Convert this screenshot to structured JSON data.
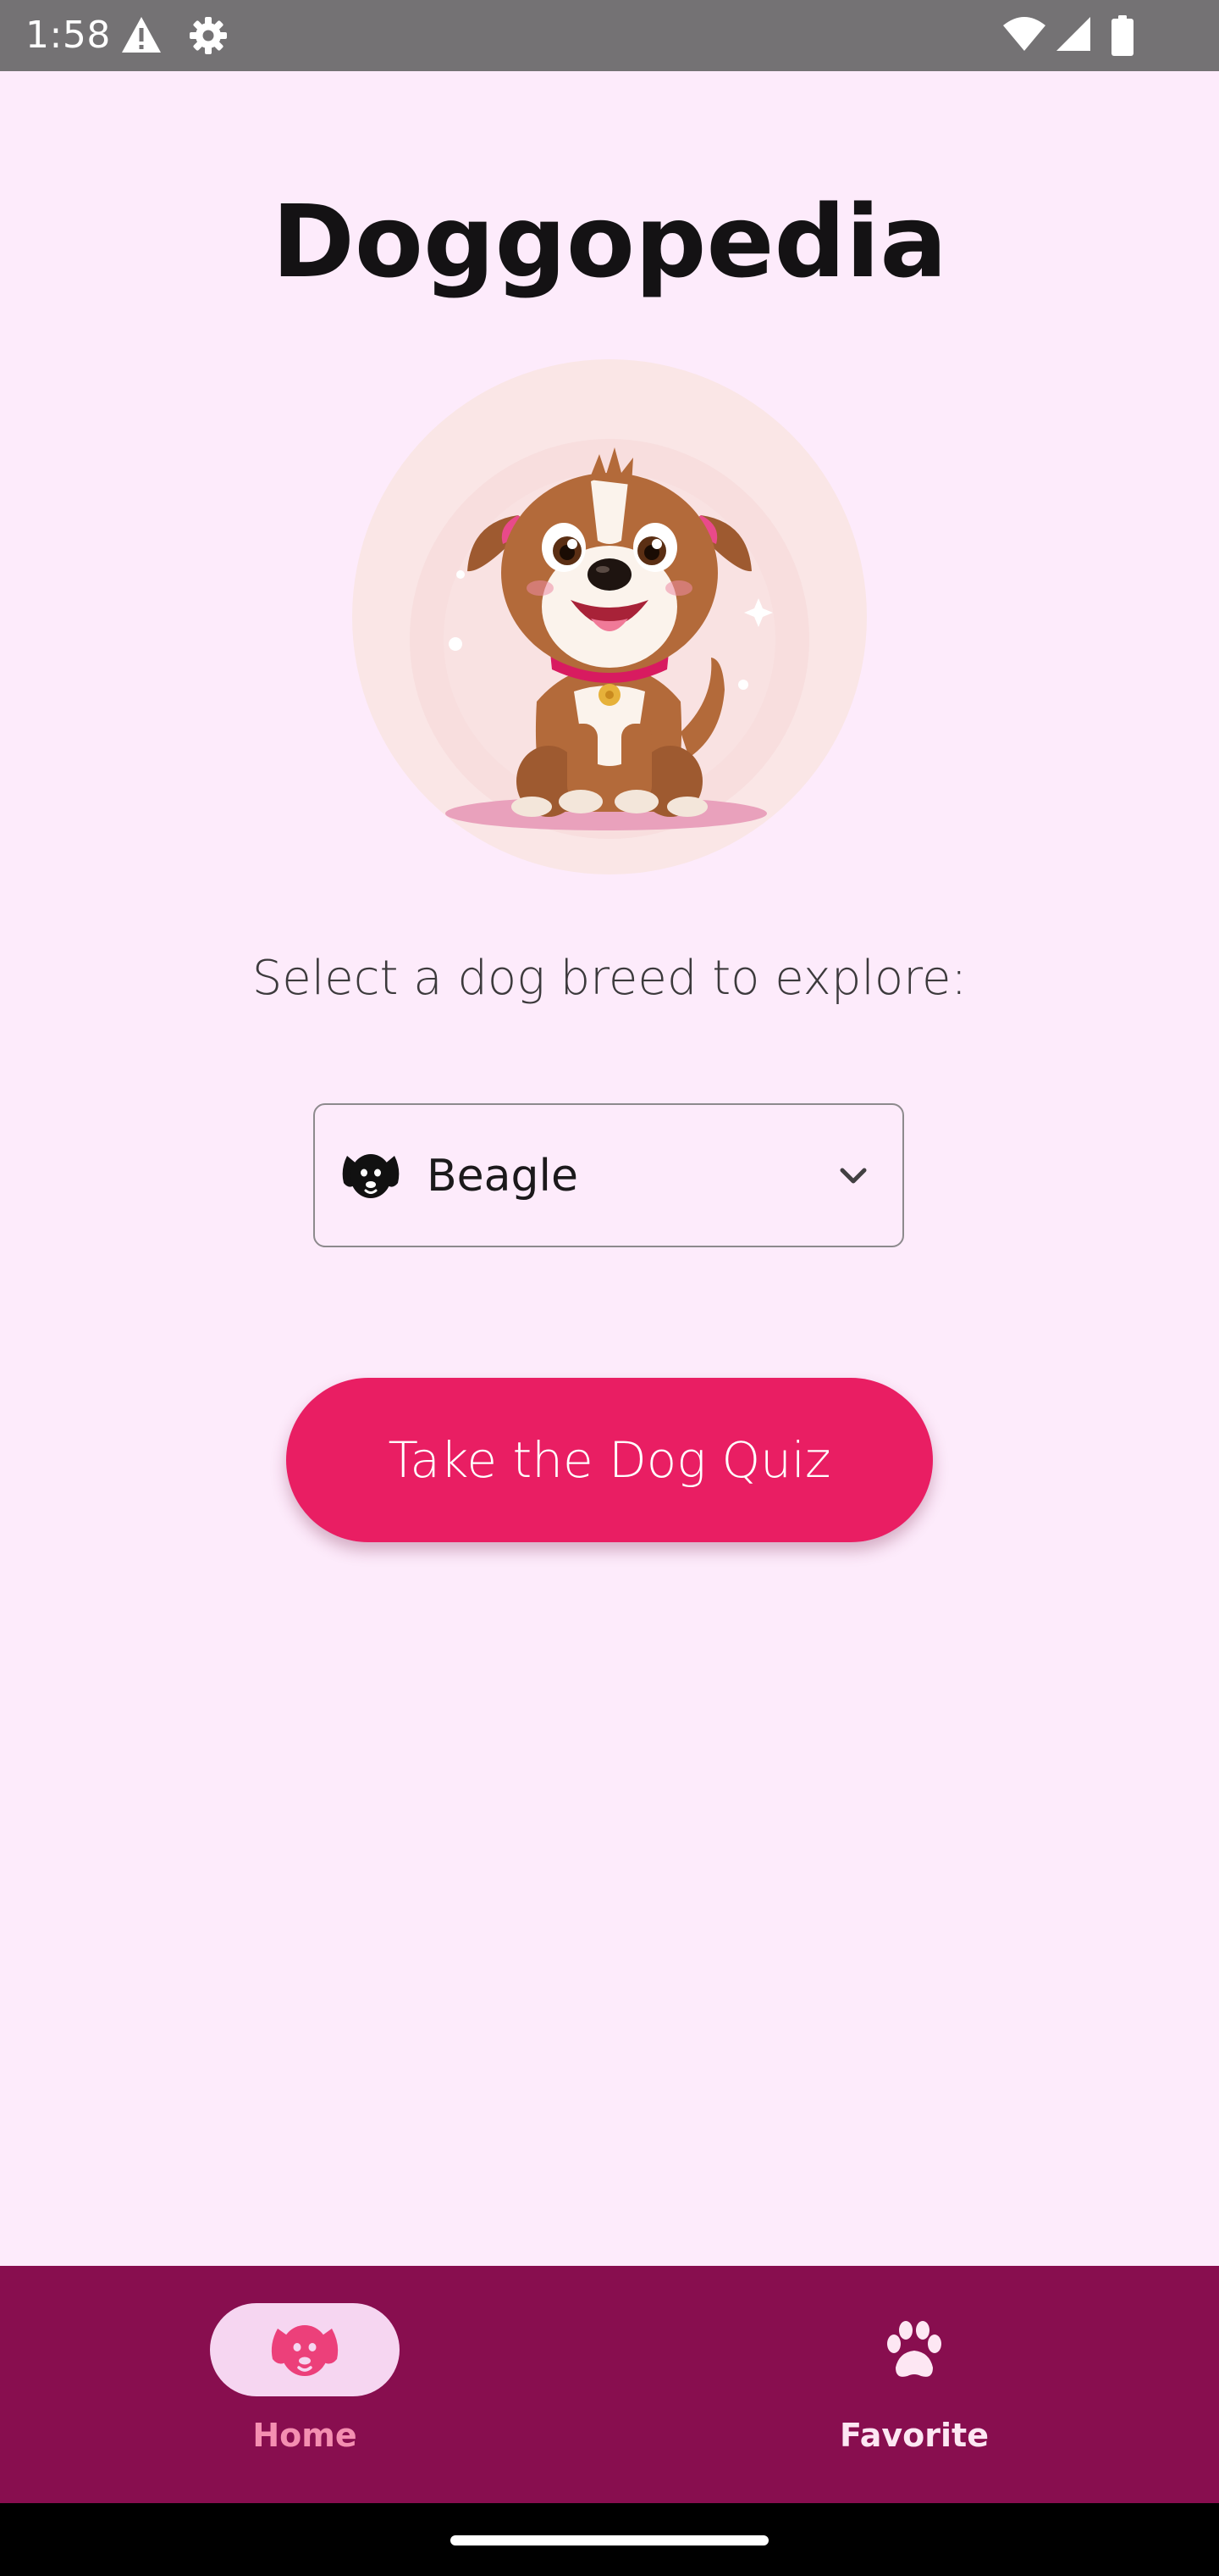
{
  "status_bar": {
    "time": "1:58",
    "icons": [
      "alert-icon",
      "settings-icon",
      "wifi-icon",
      "signal-icon",
      "battery-icon"
    ]
  },
  "app": {
    "title": "Doggopedia"
  },
  "hero": {
    "icon": "cartoon-dog-illustration"
  },
  "prompt": "Select a dog breed to explore:",
  "breed_dropdown": {
    "selected": "Beagle",
    "icon": "dog-face-icon"
  },
  "quiz_button": {
    "label": "Take the Dog Quiz"
  },
  "bottom_nav": {
    "items": [
      {
        "label": "Home",
        "icon": "dog-face-icon",
        "selected": true
      },
      {
        "label": "Favorite",
        "icon": "paw-icon",
        "selected": false
      }
    ]
  },
  "colors": {
    "background": "#fdebfb",
    "accent": "#e91e63",
    "nav_bar": "#880e4f",
    "nav_selected_pill": "#f6d6f1",
    "nav_selected_label": "#f48fb1"
  }
}
